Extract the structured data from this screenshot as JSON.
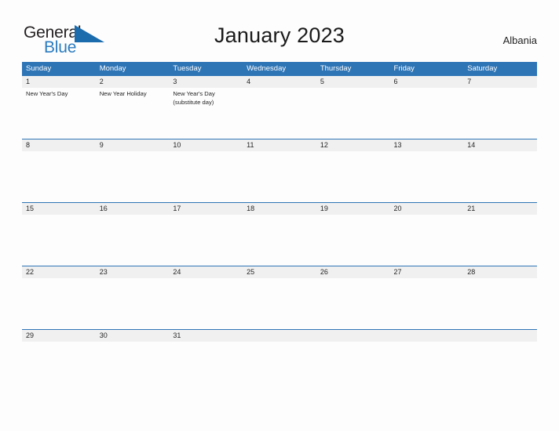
{
  "brand": {
    "name_part1": "General",
    "name_part2": "Blue",
    "flag_icon": "blue-triangle-flag",
    "color_dark": "#231f20",
    "color_blue": "#2b7cc0"
  },
  "header": {
    "title": "January 2023",
    "country": "Albania"
  },
  "theme": {
    "header_blue": "#2e75b6",
    "daynum_gray": "#f0f0f0",
    "page_background": "#fdfdfd"
  },
  "calendar": {
    "month": "January",
    "year": "2023",
    "weekday_headers": [
      "Sunday",
      "Monday",
      "Tuesday",
      "Wednesday",
      "Thursday",
      "Friday",
      "Saturday"
    ],
    "weeks": [
      {
        "days": [
          {
            "num": "1",
            "events": [
              "New Year's Day"
            ]
          },
          {
            "num": "2",
            "events": [
              "New Year Holiday"
            ]
          },
          {
            "num": "3",
            "events": [
              "New Year's Day (substitute day)"
            ]
          },
          {
            "num": "4",
            "events": []
          },
          {
            "num": "5",
            "events": []
          },
          {
            "num": "6",
            "events": []
          },
          {
            "num": "7",
            "events": []
          }
        ]
      },
      {
        "days": [
          {
            "num": "8",
            "events": []
          },
          {
            "num": "9",
            "events": []
          },
          {
            "num": "10",
            "events": []
          },
          {
            "num": "11",
            "events": []
          },
          {
            "num": "12",
            "events": []
          },
          {
            "num": "13",
            "events": []
          },
          {
            "num": "14",
            "events": []
          }
        ]
      },
      {
        "days": [
          {
            "num": "15",
            "events": []
          },
          {
            "num": "16",
            "events": []
          },
          {
            "num": "17",
            "events": []
          },
          {
            "num": "18",
            "events": []
          },
          {
            "num": "19",
            "events": []
          },
          {
            "num": "20",
            "events": []
          },
          {
            "num": "21",
            "events": []
          }
        ]
      },
      {
        "days": [
          {
            "num": "22",
            "events": []
          },
          {
            "num": "23",
            "events": []
          },
          {
            "num": "24",
            "events": []
          },
          {
            "num": "25",
            "events": []
          },
          {
            "num": "26",
            "events": []
          },
          {
            "num": "27",
            "events": []
          },
          {
            "num": "28",
            "events": []
          }
        ]
      },
      {
        "days": [
          {
            "num": "29",
            "events": []
          },
          {
            "num": "30",
            "events": []
          },
          {
            "num": "31",
            "events": []
          },
          {
            "num": "",
            "events": []
          },
          {
            "num": "",
            "events": []
          },
          {
            "num": "",
            "events": []
          },
          {
            "num": "",
            "events": []
          }
        ]
      }
    ]
  }
}
